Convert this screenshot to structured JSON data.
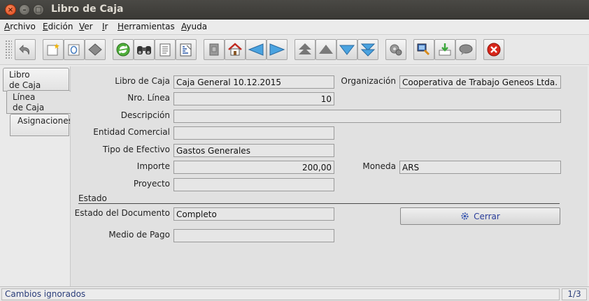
{
  "window": {
    "title": "Libro de Caja"
  },
  "menu": [
    {
      "label": "Archivo",
      "mnemonic": "A",
      "rest": "rchivo"
    },
    {
      "label": "Edición",
      "mnemonic": "E",
      "rest": "dición"
    },
    {
      "label": "Ver",
      "mnemonic": "V",
      "rest": "er"
    },
    {
      "label": "Ir",
      "mnemonic": "I",
      "rest": "r"
    },
    {
      "label": "Herramientas",
      "mnemonic": "H",
      "rest": "erramientas"
    },
    {
      "label": "Ayuda",
      "mnemonic": "A",
      "rest": "yuda"
    }
  ],
  "toolbar": {
    "icons": [
      "undo-icon",
      "new-record-icon",
      "copy-record-icon",
      "delete-record-icon",
      "refresh-icon",
      "find-icon",
      "report-icon",
      "detail-record-icon",
      "archive-icon",
      "home-icon",
      "previous-tab-icon",
      "next-tab-icon",
      "first-record-icon",
      "previous-record-icon",
      "next-record-icon",
      "last-record-icon",
      "process-icon",
      "zoom-across-icon",
      "import-icon",
      "chat-icon",
      "close-window-icon"
    ]
  },
  "tabs": [
    {
      "line1": "Libro",
      "line2": "de Caja"
    },
    {
      "line1": "Línea",
      "line2": "de Caja"
    },
    {
      "line1": "Asignaciones",
      "line2": ""
    }
  ],
  "form": {
    "libro_de_caja": {
      "label": "Libro de Caja",
      "value": "Caja General 10.12.2015"
    },
    "organizacion": {
      "label": "Organización",
      "value": "Cooperativa de Trabajo Geneos Ltda."
    },
    "nro_linea": {
      "label": "Nro. Línea",
      "value": "10"
    },
    "descripcion": {
      "label": "Descripción",
      "value": ""
    },
    "entidad_comercial": {
      "label": "Entidad Comercial",
      "value": ""
    },
    "tipo_efectivo": {
      "label": "Tipo de Efectivo",
      "value": "Gastos Generales"
    },
    "importe": {
      "label": "Importe",
      "value": "200,00"
    },
    "moneda": {
      "label": "Moneda",
      "value": "ARS"
    },
    "proyecto": {
      "label": "Proyecto",
      "value": ""
    },
    "estado_section": "Estado",
    "estado_documento": {
      "label": "Estado del Documento",
      "value": "Completo"
    },
    "medio_pago": {
      "label": "Medio de Pago",
      "value": ""
    },
    "cerrar_button": "Cerrar"
  },
  "status": {
    "message": "Cambios ignorados",
    "record": "1/3"
  },
  "colors": {
    "titlebar": "#3e3d39",
    "close": "#e95420",
    "link_blue": "#2a3d9a"
  }
}
